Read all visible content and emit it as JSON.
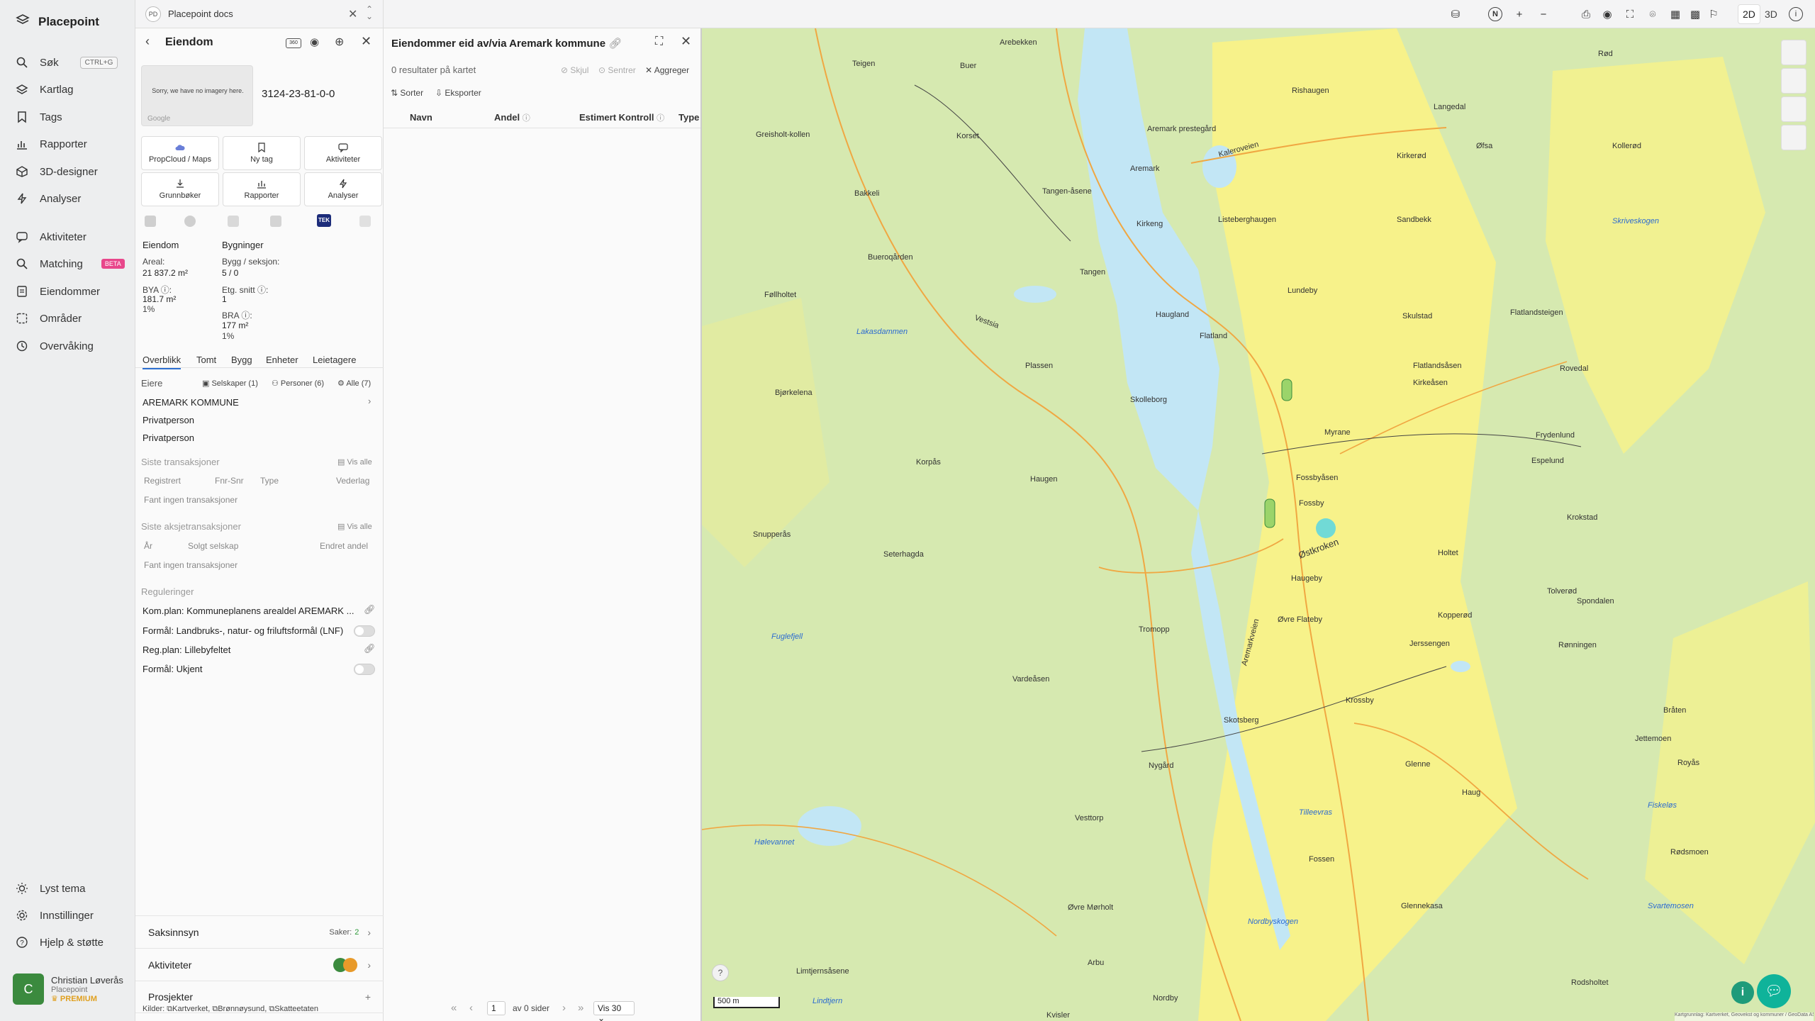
{
  "app": {
    "name": "Placepoint"
  },
  "nav": {
    "search": "Søk",
    "search_kbd": "CTRL+G",
    "layers": "Kartlag",
    "tags": "Tags",
    "reports": "Rapporter",
    "designer3d": "3D-designer",
    "analyses": "Analyser",
    "activities": "Aktiviteter",
    "matching": "Matching",
    "matching_badge": "BETA",
    "properties": "Eiendommer",
    "areas": "Områder",
    "monitoring": "Overvåking",
    "theme": "Lyst tema",
    "settings": "Innstillinger",
    "help": "Hjelp & støtte"
  },
  "user": {
    "initial": "C",
    "name": "Christian Løverås",
    "org": "Placepoint",
    "plan": "PREMIUM"
  },
  "doc_tab": {
    "badge": "PD",
    "title": "Placepoint docs"
  },
  "property": {
    "header": "Eiendom",
    "no_imagery": "Sorry, we have no imagery here.",
    "google": "Google",
    "id": "3124-23-81-0-0",
    "actions": [
      "PropCloud / Maps",
      "Ny tag",
      "Aktiviteter",
      "Grunnbøker",
      "Rapporter",
      "Analyser"
    ],
    "tek_badge": "TEK",
    "eiendom_label": "Eiendom",
    "areal_label": "Areal:",
    "areal_value": "21 837.2 m²",
    "bya_label": "BYA ⓘ:",
    "bya_value": "181.7 m²",
    "bya_pct": "1%",
    "bygninger_label": "Bygninger",
    "bygg_label": "Bygg / seksjon:",
    "bygg_value": "5 / 0",
    "etg_label": "Etg. snitt ⓘ:",
    "etg_value": "1",
    "bra_label": "BRA ⓘ:",
    "bra_value": "177 m²",
    "bra_pct": "1%",
    "tabs": [
      "Overblikk",
      "Tomt",
      "Bygg",
      "Enheter",
      "Leietagere"
    ],
    "owners_label": "Eiere",
    "owners_filters": [
      "Selskaper (1)",
      "Personer (6)",
      "Alle (7)"
    ],
    "owners": [
      "AREMARK KOMMUNE",
      "Privatperson",
      "Privatperson"
    ],
    "transactions_label": "Siste transaksjoner",
    "see_all": "Vis alle",
    "trans_cols": [
      "Registrert",
      "Fnr-Snr",
      "Type",
      "Vederlag"
    ],
    "trans_empty": "Fant ingen transaksjoner",
    "share_label": "Siste aksjetransaksjoner",
    "share_cols": [
      "År",
      "Solgt selskap",
      "Endret andel"
    ],
    "share_empty": "Fant ingen transaksjoner",
    "reg_label": "Reguleringer",
    "reg_rows": [
      "Kom.plan: Kommuneplanens arealdel AREMARK ...",
      "Formål: Landbruks-, natur- og friluftsformål (LNF)",
      "Reg.plan: Lillebyfeltet",
      "Formål: Ukjent"
    ],
    "case_label": "Saksinnsyn",
    "case_count_label": "Saker:",
    "case_count": "2",
    "activities_label": "Aktiviteter",
    "projects_label": "Prosjekter",
    "sources_label": "Kilder:",
    "sources": [
      "Kartverket,",
      "Brønnøysund,",
      "Skatteetaten"
    ]
  },
  "results": {
    "title": "Eiendommer eid av/via Aremark kommune",
    "count": "0 resultater på kartet",
    "hide": "Skjul",
    "center": "Sentrer",
    "aggregate": "Aggreger",
    "sort": "Sorter",
    "export": "Eksporter",
    "cols": [
      "Navn",
      "Andel",
      "Estimert Kontroll",
      "Type"
    ],
    "page": "1",
    "of_pages": "av 0 sider",
    "per_page": "Vis 30"
  },
  "map": {
    "mode_2d": "2D",
    "mode_3d": "3D",
    "scale": "500 m",
    "attribution": "Kartgrunnlag: Kartverket, Geovekst og kommuner / GeoData AS. Powered by Esri",
    "places": [
      "Arebekken",
      "Rød",
      "Teigen",
      "Buer",
      "Rishaugen",
      "Langedal",
      "Aremark prestegård",
      "Aremark",
      "Kaleroveien",
      "Kirkerød",
      "Øfsa",
      "Kollerød",
      "Greisholt-kollen",
      "Korset",
      "Tangen-åsene",
      "Bakkeli",
      "Kirkeng",
      "Listeberghaugen",
      "Sandbekk",
      "Skriveskogen",
      "Bueroqården",
      "Tangen",
      "Lundeby",
      "Føllholtet",
      "Vestsia",
      "Haugland",
      "Skulstad",
      "Flatlandsteigen",
      "Lakasdammen",
      "Flatland",
      "Plassen",
      "Flatlandsåsen",
      "Kirkeåsen",
      "Rovedal",
      "Bjørkelena",
      "Skolleborg",
      "Myrane",
      "Frydenlund",
      "Korpås",
      "Haugen",
      "Fossbyåsen",
      "Espelund",
      "Fossby",
      "Krokstad",
      "Snupperås",
      "Seterhagda",
      "Østkroken",
      "Holtet",
      "Haugeby",
      "Tolverød",
      "Spondalen",
      "Fuglefjell",
      "Aremarkveien",
      "Øvre Flateby",
      "Jerssengen",
      "Kopperød",
      "Rønningen",
      "Tromopp",
      "Vardeåsen",
      "Krossby",
      "Bråten",
      "Skotsberg",
      "Jettemoen",
      "Nygård",
      "Glenne",
      "Royås",
      "Haug",
      "Vesttorp",
      "Fiskeløs",
      "Hølevannet",
      "Tilleevras",
      "Fossen",
      "Rødsmoen",
      "Glennekasa",
      "Svartemosen",
      "Øvre Mørholt",
      "Nordbyskogen",
      "Arbu",
      "Limtjernsåsene",
      "Nordby",
      "Rodsholtet",
      "Lindtjern",
      "Kvisler"
    ]
  },
  "colors": {
    "accent": "#2d6fd0",
    "map_green": "#d6e9b0",
    "map_yellow": "#f7f28a",
    "water": "#c2e6f5",
    "avatar": "#3b8a3e",
    "beta": "#e8478b"
  }
}
